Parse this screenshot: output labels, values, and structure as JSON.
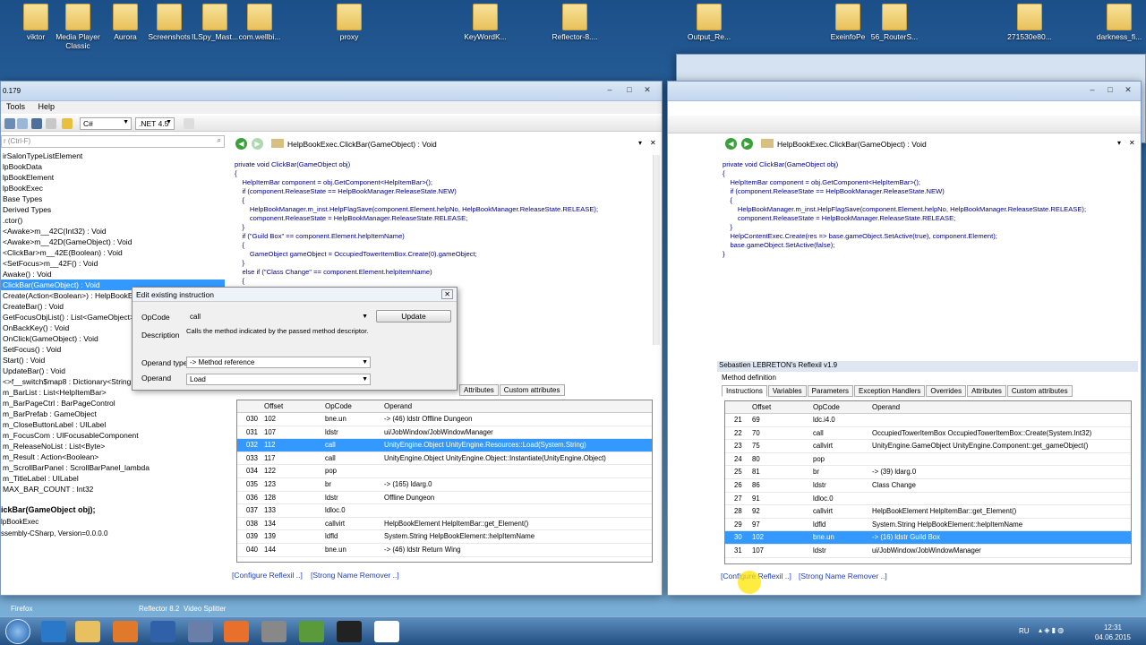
{
  "desktop_icons": [
    "viktor",
    "Media Player Classic",
    "Aurora",
    "Screenshots",
    "ILSpy_Mast...",
    "com.wellbi...",
    "proxy",
    "KeyWordK...",
    "Reflector-8....",
    "Output_Re...",
    "ExeinfoPe",
    "56_RouterS...",
    "271530e80...",
    "darkness_fi..."
  ],
  "left_window": {
    "version": "0.179",
    "menu": [
      "Tools",
      "Help"
    ],
    "toolbar": {
      "language": "C#",
      "framework": ".NET 4.5"
    },
    "search_placeholder": "r (Ctrl-F)",
    "tree_items": [
      "irSalonTypeListElement",
      "lpBookData",
      "lpBookElement",
      "lpBookExec",
      "Base Types",
      "Derived Types",
      ".ctor()",
      "<Awake>m__42C(Int32) : Void",
      "<Awake>m__42D(GameObject) : Void",
      "<ClickBar>m__42E(Boolean) : Void",
      "<SetFocus>m__42F() : Void",
      "Awake() : Void",
      "ClickBar(GameObject) : Void",
      "Create(Action<Boolean>) : HelpBookExe",
      "CreateBar() : Void",
      "GetFocusObjList() : List<GameObject>",
      "OnBackKey() : Void",
      "OnClick(GameObject) : Void",
      "SetFocus() : Void",
      "Start() : Void",
      "UpdateBar() : Void",
      "<>f__switch$map8 : Dictionary<String,",
      "m_BarList : List<HelpItemBar>",
      "m_BarPageCtrl : BarPageControl",
      "m_BarPrefab : GameObject",
      "m_CloseButtonLabel : UILabel",
      "m_FocusCom : UIFocusableComponent",
      "m_ReleaseNoList : List<Byte>",
      "m_Result : Action<Boolean>",
      "m_ScrollBarPanel : ScrollBarPanel_lambda",
      "m_TitleLabel : UILabel",
      "MAX_BAR_COUNT : Int32"
    ],
    "selected_index": 12,
    "info": [
      "ickBar(GameObject obj);",
      "lpBookExec",
      "ssembly-CSharp, Version=0.0.0.0"
    ],
    "tab_title": "HelpBookExec.ClickBar(GameObject) : Void",
    "code": [
      "private void ClickBar(GameObject obj)",
      "{",
      "    HelpItemBar component = obj.GetComponent<HelpItemBar>();",
      "    if (component.ReleaseState == HelpBookManager.ReleaseState.NEW)",
      "    {",
      "        HelpBookManager.m_inst.HelpFlagSave(component.Element.helpNo, HelpBookManager.ReleaseState.RELEASE);",
      "        component.ReleaseState = HelpBookManager.ReleaseState.RELEASE;",
      "    }",
      "    if (\"Guild Box\" == component.Element.helpItemName)",
      "    {",
      "        GameObject gameObject = OccupiedTowerItemBox.Create(0).gameObject;",
      "    }",
      "    else if (\"Class Change\" == component.Element.helpItemName)",
      "    {",
      "                                                              ager\"));",
      "",
      "",
      "",
      "                                                              mDungeon/DungeonSelectMenu\");"
    ],
    "tabs": [
      "Attributes",
      "Custom attributes"
    ],
    "grid_headers": [
      "Offset",
      "OpCode",
      "Operand"
    ],
    "rows": [
      [
        "030",
        "102",
        "bne.un",
        "-> (46) ldstr Offline Dungeon"
      ],
      [
        "031",
        "107",
        "ldstr",
        "ui/JobWindow/JobWindowManager"
      ],
      [
        "032",
        "112",
        "call",
        "UnityEngine.Object UnityEngine.Resources::Load(System.String)"
      ],
      [
        "033",
        "117",
        "call",
        "UnityEngine.Object UnityEngine.Object::Instantiate(UnityEngine.Object)"
      ],
      [
        "034",
        "122",
        "pop",
        ""
      ],
      [
        "035",
        "123",
        "br",
        "-> (165) ldarg.0"
      ],
      [
        "036",
        "128",
        "ldstr",
        "Offline Dungeon"
      ],
      [
        "037",
        "133",
        "ldloc.0",
        ""
      ],
      [
        "038",
        "134",
        "callvirt",
        "HelpBookElement HelpItemBar::get_Element()"
      ],
      [
        "039",
        "139",
        "ldfld",
        "System.String HelpBookElement::helpItemName"
      ],
      [
        "040",
        "144",
        "bne.un",
        "-> (46) ldstr Return Wing"
      ]
    ],
    "selected_row": 2,
    "links": [
      "[Configure Reflexil ..]",
      "[Strong Name Remover ..]"
    ]
  },
  "dialog": {
    "title": "Edit existing instruction",
    "opcode_label": "OpCode",
    "opcode_value": "call",
    "update_button": "Update",
    "description_label": "Description",
    "description_value": "Calls the method indicated by the passed method descriptor.",
    "operand_type_label": "Operand type",
    "operand_type_value": "-> Method reference",
    "operand_label": "Operand",
    "operand_value": "Load"
  },
  "right_window": {
    "tab_title": "HelpBookExec.ClickBar(GameObject) : Void",
    "code": [
      "private void ClickBar(GameObject obj)",
      "{",
      "    HelpItemBar component = obj.GetComponent<HelpItemBar>();",
      "    if (component.ReleaseState == HelpBookManager.ReleaseState.NEW)",
      "    {",
      "        HelpBookManager.m_inst.HelpFlagSave(component.Element.helpNo, HelpBookManager.ReleaseState.RELEASE);",
      "        component.ReleaseState = HelpBookManager.ReleaseState.RELEASE;",
      "    }",
      "    HelpContentExec.Create(res => base.gameObject.SetActive(true), component.Element);",
      "    base.gameObject.SetActive(false);",
      "}"
    ],
    "reflexil_title": "Sebastien LEBRETON's Reflexil v1.9",
    "method_definition": "Method definition",
    "tabs": [
      "Instructions",
      "Variables",
      "Parameters",
      "Exception Handlers",
      "Overrides",
      "Attributes",
      "Custom attributes"
    ],
    "grid_headers": [
      "Offset",
      "OpCode",
      "Operand"
    ],
    "rows": [
      [
        "21",
        "69",
        "ldc.i4.0",
        ""
      ],
      [
        "22",
        "70",
        "call",
        "OccupiedTowerItemBox OccupiedTowerItemBox::Create(System.Int32)"
      ],
      [
        "23",
        "75",
        "callvirt",
        "UnityEngine.GameObject UnityEngine.Component::get_gameObject()"
      ],
      [
        "24",
        "80",
        "pop",
        ""
      ],
      [
        "25",
        "81",
        "br",
        "-> (39) ldarg.0"
      ],
      [
        "26",
        "86",
        "ldstr",
        "Class Change"
      ],
      [
        "27",
        "91",
        "ldloc.0",
        ""
      ],
      [
        "28",
        "92",
        "callvirt",
        "HelpBookElement HelpItemBar::get_Element()"
      ],
      [
        "29",
        "97",
        "ldfld",
        "System.String HelpBookElement::helpItemName"
      ],
      [
        "30",
        "102",
        "bne.un",
        "-> (16) ldstr Guild Box"
      ],
      [
        "31",
        "107",
        "ldstr",
        "ui/JobWindow/JobWindowManager"
      ]
    ],
    "selected_row": 9,
    "links": [
      "[Configure Reflexil ..]",
      "[Strong Name Remover ..]"
    ]
  },
  "taskbar": {
    "items": [
      "Firefox",
      "Reflector 8.2",
      "Video Splitter"
    ],
    "lang": "RU",
    "time": "12:31",
    "date": "04.06.2015"
  },
  "colors": {
    "selection": "#3399ff",
    "code": "#00008b",
    "link": "#1f3fbf"
  }
}
